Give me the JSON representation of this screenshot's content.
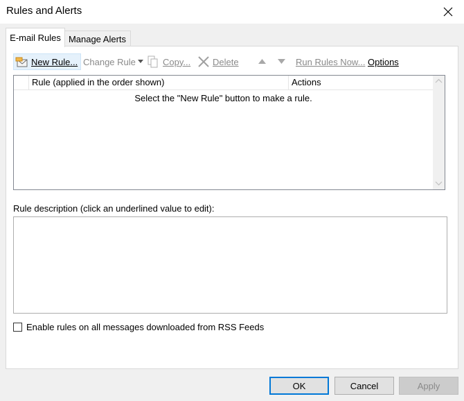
{
  "window": {
    "title": "Rules and Alerts",
    "close_icon": "close-icon"
  },
  "tabs": [
    {
      "label": "E-mail Rules",
      "active": true
    },
    {
      "label": "Manage Alerts",
      "active": false
    }
  ],
  "toolbar": {
    "new_rule": {
      "label": "New Rule...",
      "icon": "new-rule-icon",
      "selected": true
    },
    "change_rule": {
      "label": "Change Rule",
      "icon": "chevron-down-icon",
      "disabled": true
    },
    "copy": {
      "label": "Copy...",
      "icon": "copy-icon",
      "disabled": true
    },
    "delete": {
      "label": "Delete",
      "icon": "delete-icon",
      "disabled": true
    },
    "move_up": {
      "icon": "triangle-up-icon",
      "disabled": true
    },
    "move_down": {
      "icon": "triangle-down-icon",
      "disabled": true
    },
    "run_rules_now": {
      "label": "Run Rules Now...",
      "disabled": true
    },
    "options": {
      "label": "Options"
    }
  },
  "rules_list": {
    "columns": [
      "Rule (applied in the order shown)",
      "Actions"
    ],
    "empty_message": "Select the \"New Rule\" button to make a rule.",
    "rows": []
  },
  "rule_description": {
    "label": "Rule description (click an underlined value to edit):",
    "value": ""
  },
  "rss_option": {
    "label": "Enable rules on all messages downloaded from RSS Feeds",
    "checked": false
  },
  "buttons": {
    "ok": "OK",
    "cancel": "Cancel",
    "apply": "Apply"
  },
  "colors": {
    "accent": "#0078d7",
    "disabled_text": "#8a8a8a",
    "selected_bg": "#e5f1fb"
  }
}
